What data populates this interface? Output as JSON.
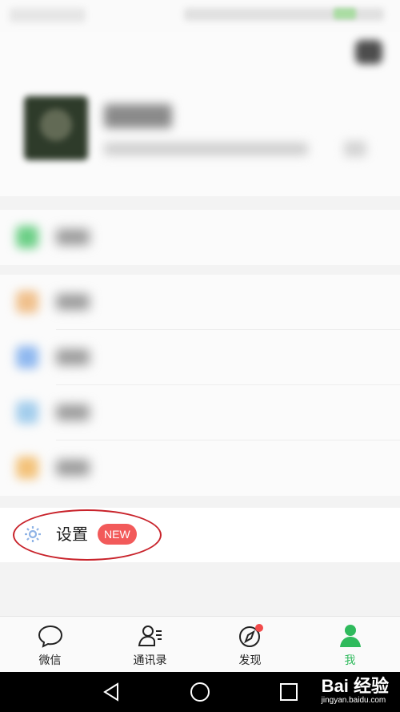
{
  "settings": {
    "label": "设置",
    "badge": "NEW"
  },
  "tabs": [
    {
      "label": "微信",
      "icon": "chat-bubble-icon",
      "active": false
    },
    {
      "label": "通讯录",
      "icon": "contacts-icon",
      "active": false
    },
    {
      "label": "发现",
      "icon": "compass-icon",
      "active": false,
      "has_dot": true
    },
    {
      "label": "我",
      "icon": "person-icon",
      "active": true
    }
  ],
  "watermark": {
    "main": "Bai 经验",
    "sub": "jingyan.baidu.com"
  },
  "colors": {
    "accent_green": "#2fba5c",
    "badge_red": "#f25a5a",
    "annotation_red": "#c8222a"
  }
}
